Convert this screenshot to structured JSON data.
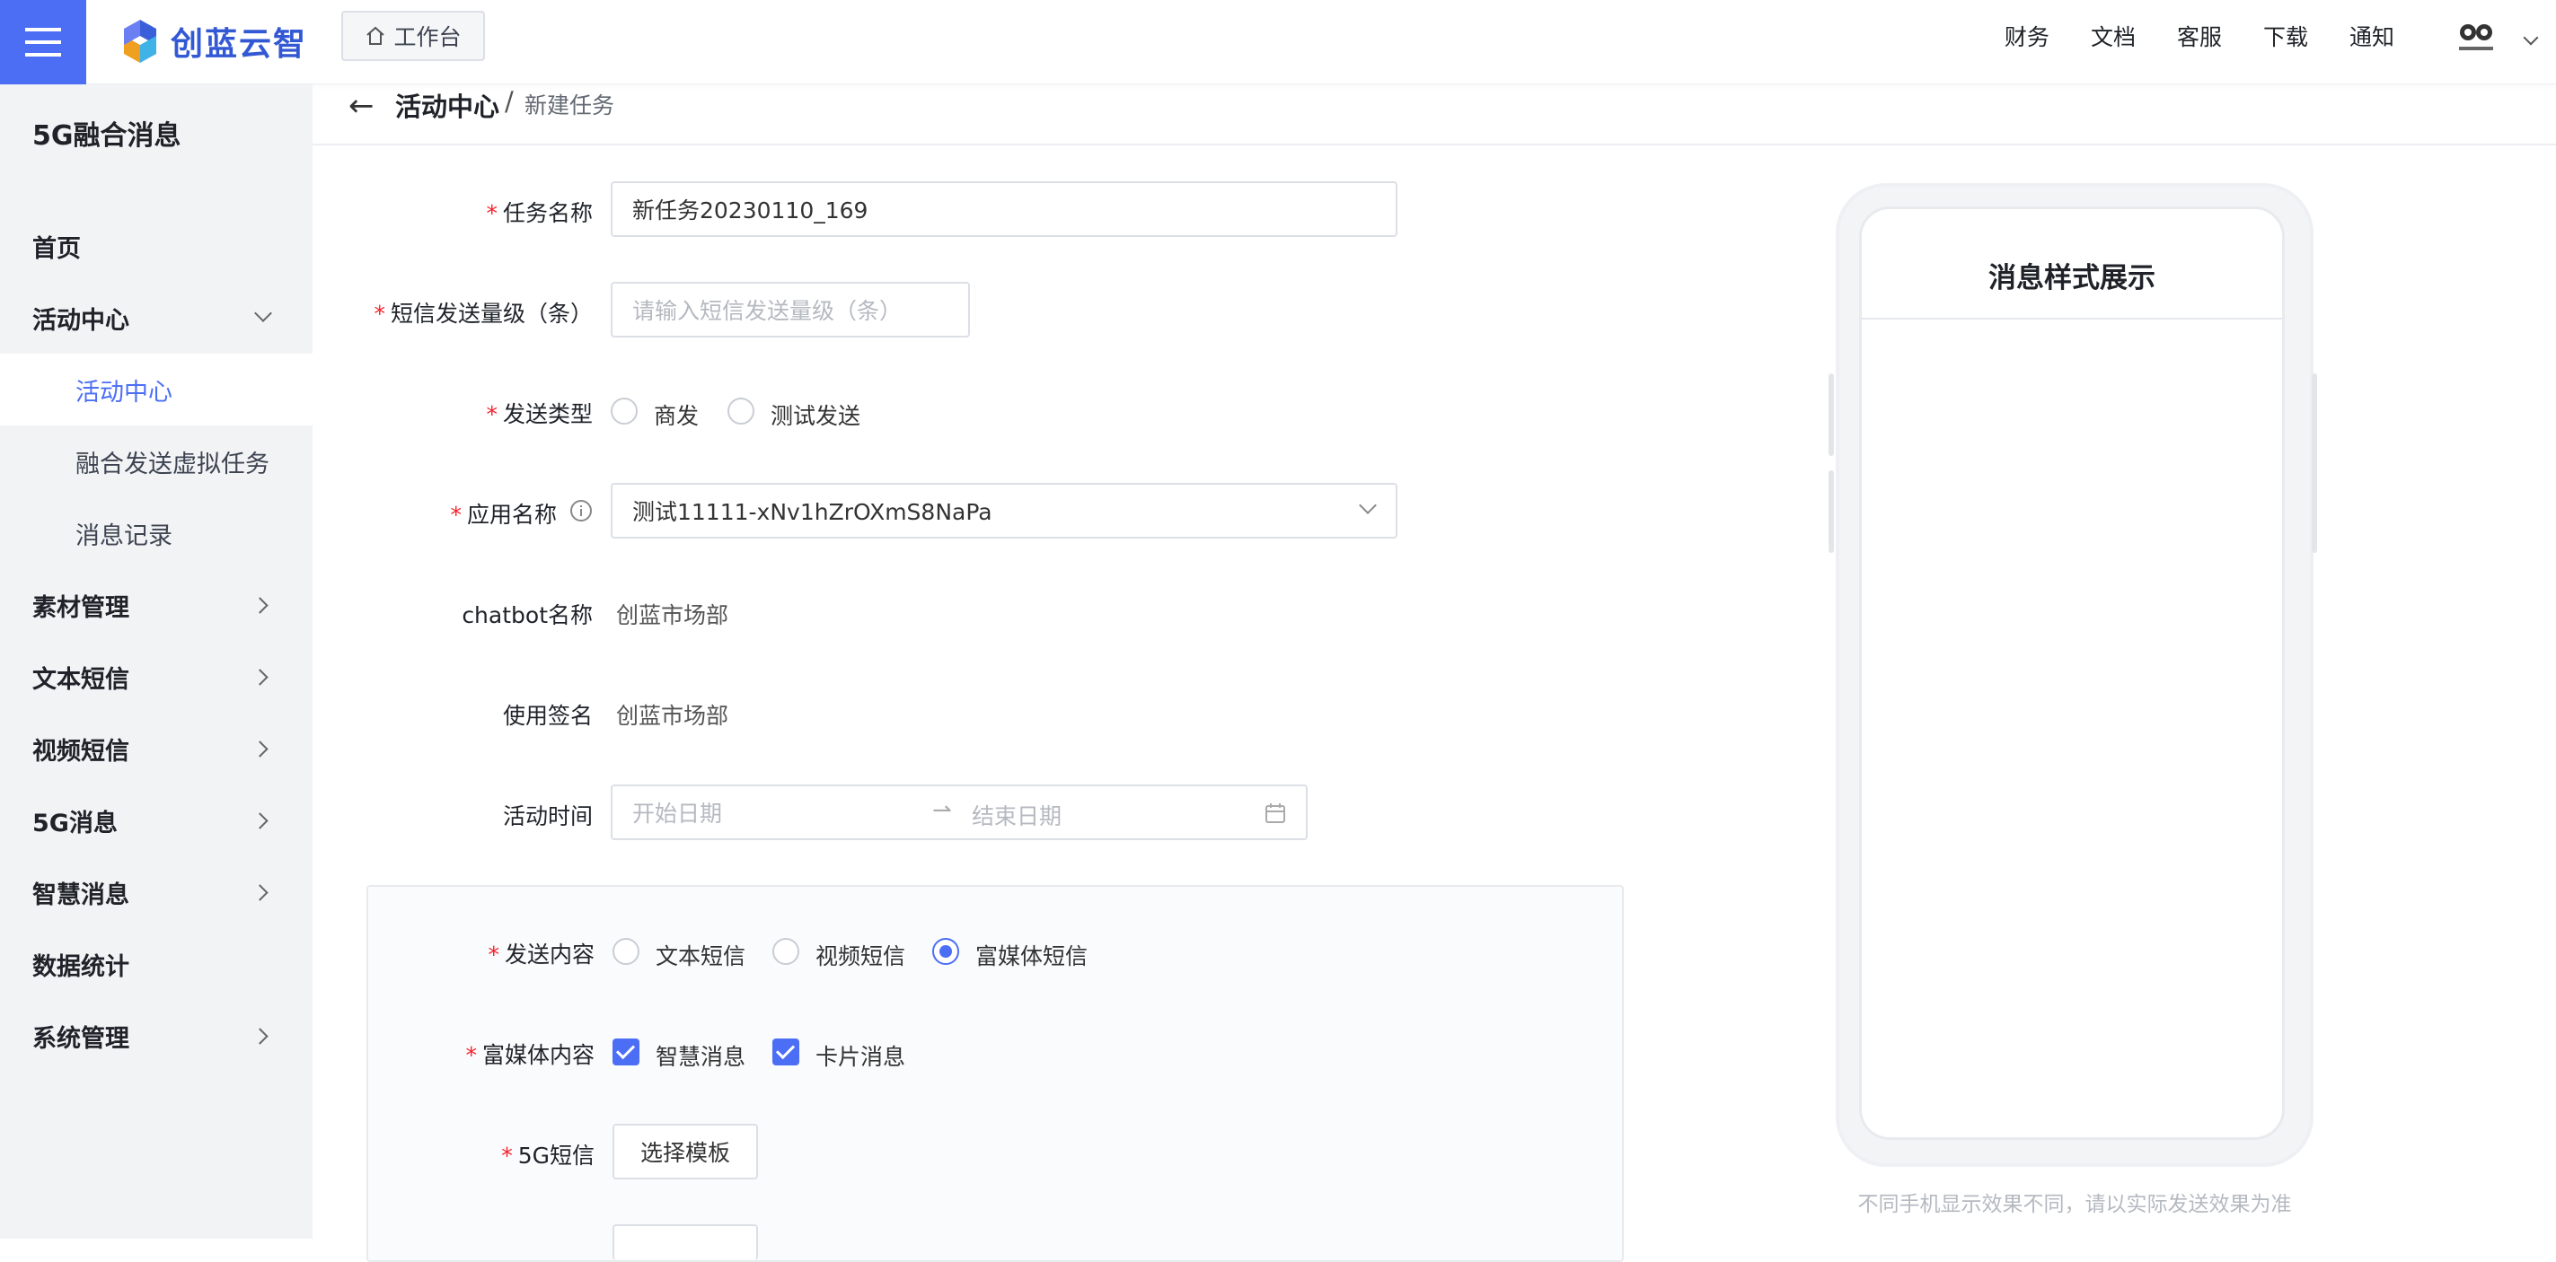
{
  "header": {
    "brand": "创蓝云智",
    "workbench_label": "工作台",
    "nav": [
      "财务",
      "文档",
      "客服",
      "下载",
      "通知"
    ]
  },
  "sidebar": {
    "title": "5G融合消息",
    "items": {
      "home": "首页",
      "activity": "活动中心",
      "activity_sub_center": "活动中心",
      "activity_sub_virtual": "融合发送虚拟任务",
      "activity_sub_records": "消息记录",
      "materials": "素材管理",
      "text_sms": "文本短信",
      "video_sms": "视频短信",
      "msg5g": "5G消息",
      "smart_msg": "智慧消息",
      "stats": "数据统计",
      "system": "系统管理"
    }
  },
  "breadcrumb": {
    "parent": "活动中心",
    "separator": "/",
    "current": "新建任务"
  },
  "form": {
    "task_name": {
      "label": "任务名称",
      "value": "新任务20230110_169"
    },
    "sms_volume": {
      "label": "短信发送量级（条）",
      "placeholder": "请输入短信发送量级（条）"
    },
    "send_type": {
      "label": "发送类型",
      "options": [
        "商发",
        "测试发送"
      ],
      "selected": null
    },
    "app_name": {
      "label": "应用名称",
      "value": "测试11111-xNv1hZrOXmS8NaPa"
    },
    "chatbot_name": {
      "label": "chatbot名称",
      "value": "创蓝市场部"
    },
    "signature": {
      "label": "使用签名",
      "value": "创蓝市场部"
    },
    "activity_time": {
      "label": "活动时间",
      "start_placeholder": "开始日期",
      "end_placeholder": "结束日期"
    },
    "send_content": {
      "label": "发送内容",
      "options": [
        "文本短信",
        "视频短信",
        "富媒体短信"
      ],
      "selected": "富媒体短信"
    },
    "rich_content": {
      "label": "富媒体内容",
      "options": [
        "智慧消息",
        "卡片消息"
      ],
      "checked": [
        "智慧消息",
        "卡片消息"
      ]
    },
    "sms5g": {
      "label": "5G短信",
      "button": "选择模板"
    }
  },
  "preview": {
    "title": "消息样式展示",
    "note": "不同手机显示效果不同，请以实际发送效果为准"
  },
  "colors": {
    "accent": "#4b6ef5",
    "required": "#f5222d",
    "sidebar_bg": "#f2f3f5"
  }
}
